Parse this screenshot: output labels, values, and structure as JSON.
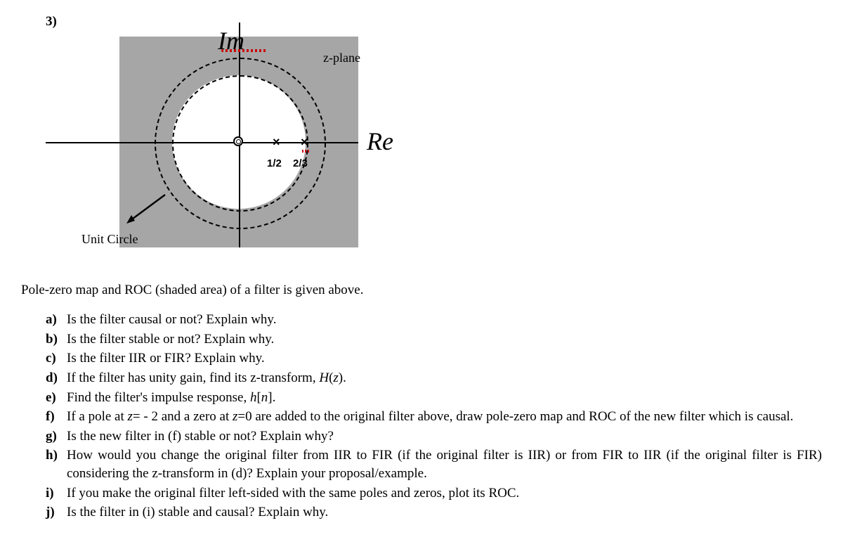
{
  "questionNumber": "3)",
  "diagram": {
    "zplaneLabel": "z-plane",
    "imLabel": "Im",
    "reLabel": "Re",
    "unitCircleLabel": "Unit Circle",
    "pole1X": "×",
    "pole2X": "×",
    "pole1Label": "1/2",
    "pole2Label": "2/3"
  },
  "description": "Pole-zero map and ROC (shaded area) of a filter is given above.",
  "questions": [
    {
      "letter": "a)",
      "text": "Is the filter causal or not? Explain why."
    },
    {
      "letter": "b)",
      "text": "Is the filter stable or not? Explain why."
    },
    {
      "letter": "c)",
      "text": "Is the filter IIR or FIR? Explain why."
    },
    {
      "letter": "d)",
      "text": "If the filter has unity gain, find its z-transform, H(z)."
    },
    {
      "letter": "e)",
      "text": "Find the filter's impulse response, h[n]."
    },
    {
      "letter": "f)",
      "text": "If a pole at z= - 2 and a zero at z=0 are added to the original filter above, draw pole-zero map and ROC of the new filter which is causal."
    },
    {
      "letter": "g)",
      "text": "Is the new filter in (f) stable or not? Explain why?"
    },
    {
      "letter": "h)",
      "text": "How would you change the original filter from IIR to FIR (if the original filter is IIR) or from FIR to IIR (if the original filter is FIR) considering the z-transform in (d)? Explain your proposal/example."
    },
    {
      "letter": "i)",
      "text": "If you make the original filter left-sided with the same poles and zeros, plot its ROC."
    },
    {
      "letter": "j)",
      "text": "Is the filter in (i) stable and causal? Explain why."
    }
  ],
  "chart_data": {
    "type": "diagram",
    "title": "Pole-zero map and ROC in z-plane",
    "zeros": [
      {
        "re": 0,
        "im": 0
      }
    ],
    "poles": [
      {
        "re": 0.5,
        "im": 0
      },
      {
        "re": 0.6667,
        "im": 0
      }
    ],
    "unit_circle_radius": 1,
    "roc": {
      "description": "Exterior of circle |z| = 2/3",
      "inner_radius": 0.6667,
      "outer_radius": "infinity"
    },
    "axis_labels": {
      "x": "Re",
      "y": "Im"
    },
    "annotations": [
      "z-plane",
      "Unit Circle",
      "1/2",
      "2/3"
    ]
  }
}
